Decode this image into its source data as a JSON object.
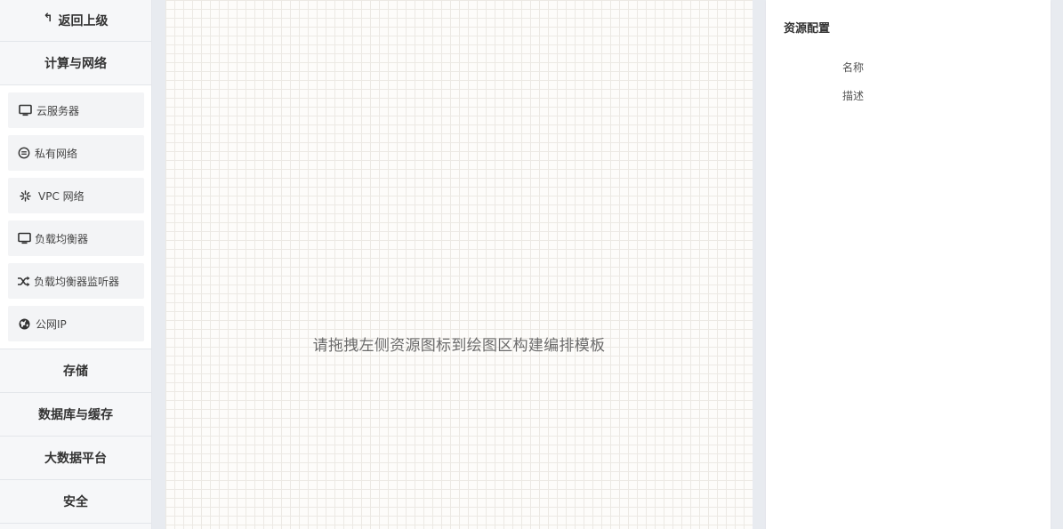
{
  "sidebar": {
    "back_label": "返回上级",
    "categories": [
      {
        "label": "计算与网络",
        "expanded": true,
        "items": [
          {
            "label": "云服务器",
            "icon": "monitor-icon"
          },
          {
            "label": "私有网络",
            "icon": "minus-circle-icon"
          },
          {
            "label": "VPC 网络",
            "icon": "asterisk-icon"
          },
          {
            "label": "负载均衡器",
            "icon": "monitor-icon"
          },
          {
            "label": "负载均衡器监听器",
            "icon": "shuffle-icon"
          },
          {
            "label": "公网IP",
            "icon": "globe-icon"
          }
        ]
      },
      {
        "label": "存储",
        "expanded": false
      },
      {
        "label": "数据库与缓存",
        "expanded": false
      },
      {
        "label": "大数据平台",
        "expanded": false
      },
      {
        "label": "安全",
        "expanded": false
      }
    ]
  },
  "canvas": {
    "hint": "请拖拽左侧资源图标到绘图区构建编排模板"
  },
  "panel": {
    "title": "资源配置",
    "fields": [
      {
        "label": "名称"
      },
      {
        "label": "描述"
      }
    ]
  },
  "colors": {
    "grid_line": "#ece9e4",
    "canvas_bg": "#fdfcfa",
    "page_bg": "#e8ebf0"
  }
}
